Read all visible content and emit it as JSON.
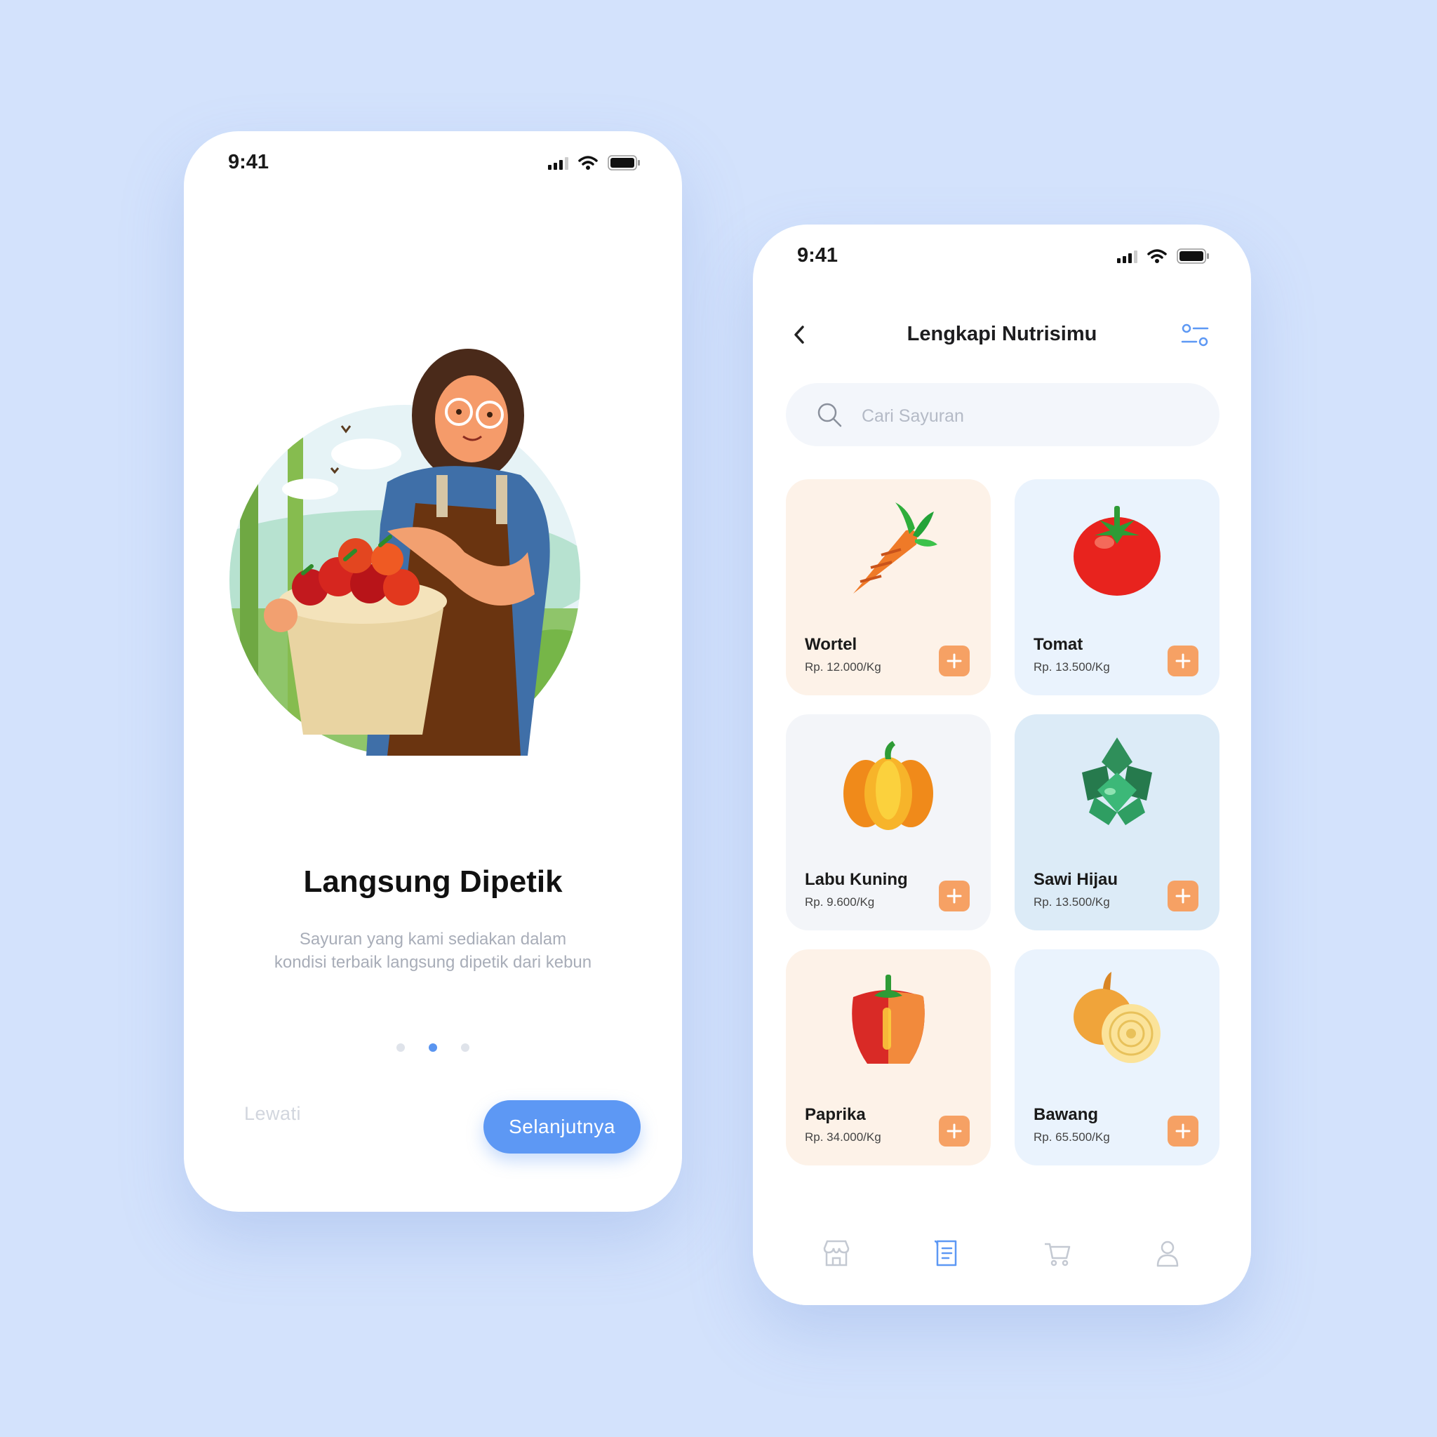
{
  "colors": {
    "background": "#d3e2fc",
    "primary": "#5d98f4",
    "accent": "#f6a164",
    "text_dark": "#1a1a1a",
    "text_muted": "#a8adb8"
  },
  "onboarding": {
    "status_time": "9:41",
    "title": "Langsung Dipetik",
    "subtitle_line1": "Sayuran yang kami sediakan  dalam",
    "subtitle_line2": "kondisi terbaik langsung dipetik dari kebun",
    "page_dots": {
      "count": 3,
      "active_index": 1
    },
    "skip_label": "Lewati",
    "next_label": "Selanjutnya"
  },
  "catalog": {
    "status_time": "9:41",
    "header": {
      "title": "Lengkapi Nutrisimu",
      "back_icon": "chevron-left-icon",
      "filter_icon": "filter-sliders-icon"
    },
    "search": {
      "placeholder": "Cari Sayuran",
      "value": ""
    },
    "products": [
      {
        "name": "Wortel",
        "price": "Rp. 12.000/Kg",
        "icon": "carrot-icon"
      },
      {
        "name": "Tomat",
        "price": "Rp. 13.500/Kg",
        "icon": "tomato-icon"
      },
      {
        "name": "Labu Kuning",
        "price": "Rp. 9.600/Kg",
        "icon": "pumpkin-icon"
      },
      {
        "name": "Sawi Hijau",
        "price": "Rp. 13.500/Kg",
        "icon": "greens-icon"
      },
      {
        "name": "Paprika",
        "price": "Rp. 34.000/Kg",
        "icon": "bell-pepper-icon"
      },
      {
        "name": "Bawang",
        "price": "Rp. 65.500/Kg",
        "icon": "onion-icon"
      }
    ],
    "bottom_nav": [
      {
        "icon": "store-icon",
        "active": false
      },
      {
        "icon": "list-document-icon",
        "active": true
      },
      {
        "icon": "cart-icon",
        "active": false
      },
      {
        "icon": "profile-icon",
        "active": false
      }
    ]
  }
}
